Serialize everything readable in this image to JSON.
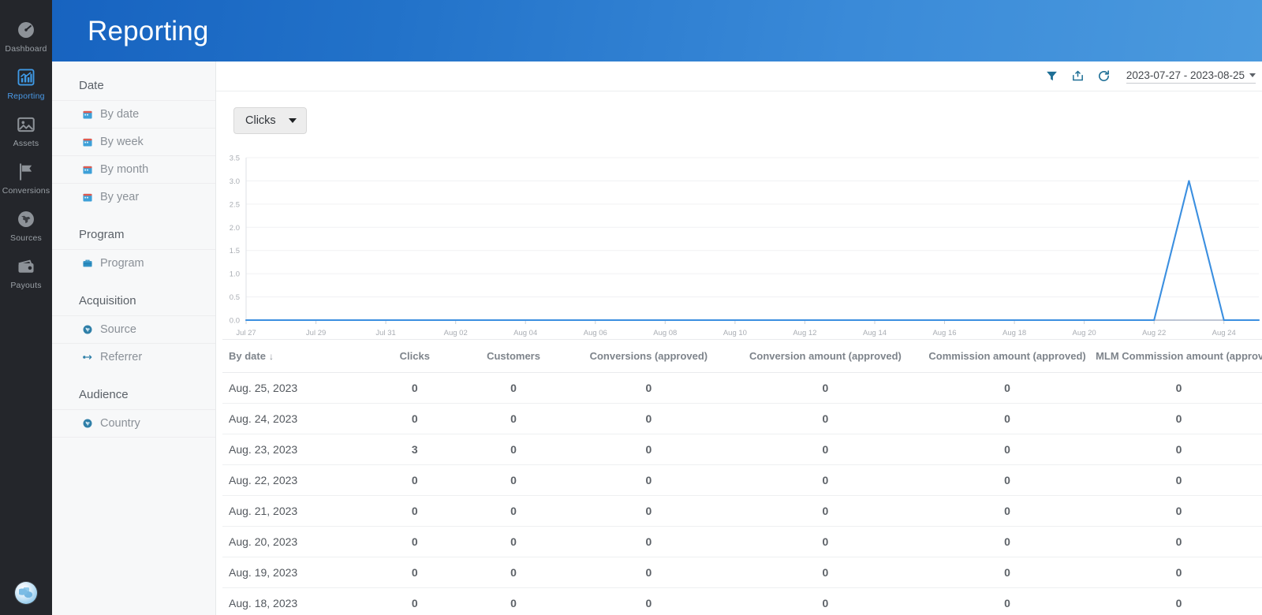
{
  "header": {
    "title": "Reporting",
    "gradient_from": "#1763c0",
    "gradient_to": "#4b9ade"
  },
  "rail": {
    "items": [
      {
        "label": "Dashboard",
        "icon": "gauge-icon",
        "active": false
      },
      {
        "label": "Reporting",
        "icon": "bar-chart-icon",
        "active": true
      },
      {
        "label": "Assets",
        "icon": "image-icon",
        "active": false
      },
      {
        "label": "Conversions",
        "icon": "flag-icon",
        "active": false
      },
      {
        "label": "Sources",
        "icon": "globe-icon",
        "active": false
      },
      {
        "label": "Payouts",
        "icon": "wallet-icon",
        "active": false
      }
    ],
    "avatar": "user-avatar"
  },
  "subnav": {
    "sections": [
      {
        "title": "Date",
        "items": [
          {
            "label": "By date",
            "icon": "calendar-icon"
          },
          {
            "label": "By week",
            "icon": "calendar-icon"
          },
          {
            "label": "By month",
            "icon": "calendar-icon"
          },
          {
            "label": "By year",
            "icon": "calendar-icon"
          }
        ]
      },
      {
        "title": "Program",
        "items": [
          {
            "label": "Program",
            "icon": "briefcase-icon"
          }
        ]
      },
      {
        "title": "Acquisition",
        "items": [
          {
            "label": "Source",
            "icon": "globe-icon"
          },
          {
            "label": "Referrer",
            "icon": "referrer-arrow-icon"
          }
        ]
      },
      {
        "title": "Audience",
        "items": [
          {
            "label": "Country",
            "icon": "globe-icon"
          }
        ]
      }
    ]
  },
  "toolbar": {
    "filter_icon": "filter-funnel-icon",
    "export_icon": "export-icon",
    "refresh_icon": "refresh-icon",
    "date_range": "2023-07-27 - 2023-08-25"
  },
  "metric_selector": {
    "value": "Clicks"
  },
  "chart_data": {
    "type": "line",
    "title": "",
    "xlabel": "",
    "ylabel": "",
    "ylim": [
      0,
      3.5
    ],
    "grid": true,
    "legend": null,
    "line_color": "#3b8fe0",
    "series": [
      {
        "name": "Clicks",
        "values": [
          0,
          0,
          0,
          0,
          0,
          0,
          0,
          0,
          0,
          0,
          0,
          0,
          0,
          0,
          0,
          0,
          0,
          0,
          0,
          0,
          0,
          0,
          0,
          0,
          0,
          0,
          0,
          3,
          0,
          0
        ]
      }
    ],
    "x": [
      "Jul 27",
      "Jul 28",
      "Jul 29",
      "Jul 30",
      "Jul 31",
      "Aug 01",
      "Aug 02",
      "Aug 03",
      "Aug 04",
      "Aug 05",
      "Aug 06",
      "Aug 07",
      "Aug 08",
      "Aug 09",
      "Aug 10",
      "Aug 11",
      "Aug 12",
      "Aug 13",
      "Aug 14",
      "Aug 15",
      "Aug 16",
      "Aug 17",
      "Aug 18",
      "Aug 19",
      "Aug 20",
      "Aug 21",
      "Aug 22",
      "Aug 23",
      "Aug 24",
      "Aug 25"
    ],
    "xticks": [
      "Jul 27",
      "Jul 29",
      "Jul 31",
      "Aug 02",
      "Aug 04",
      "Aug 06",
      "Aug 08",
      "Aug 10",
      "Aug 12",
      "Aug 14",
      "Aug 16",
      "Aug 18",
      "Aug 20",
      "Aug 22",
      "Aug 24"
    ],
    "yticks": [
      "0.0",
      "0.5",
      "1.0",
      "1.5",
      "2.0",
      "2.5",
      "3.0",
      "3.5"
    ]
  },
  "table": {
    "sort_column": "By date",
    "sort_direction": "desc",
    "columns": [
      "By date",
      "Clicks",
      "Customers",
      "Conversions (approved)",
      "Conversion amount (approved)",
      "Commission amount (approved)",
      "MLM Commission amount (approved)"
    ],
    "rows": [
      {
        "date": "Aug. 25, 2023",
        "clicks": "0",
        "customers": "0",
        "conversions": "0",
        "conversion_amount": "0",
        "commission_amount": "0",
        "mlm_commission_amount": "0"
      },
      {
        "date": "Aug. 24, 2023",
        "clicks": "0",
        "customers": "0",
        "conversions": "0",
        "conversion_amount": "0",
        "commission_amount": "0",
        "mlm_commission_amount": "0"
      },
      {
        "date": "Aug. 23, 2023",
        "clicks": "3",
        "customers": "0",
        "conversions": "0",
        "conversion_amount": "0",
        "commission_amount": "0",
        "mlm_commission_amount": "0"
      },
      {
        "date": "Aug. 22, 2023",
        "clicks": "0",
        "customers": "0",
        "conversions": "0",
        "conversion_amount": "0",
        "commission_amount": "0",
        "mlm_commission_amount": "0"
      },
      {
        "date": "Aug. 21, 2023",
        "clicks": "0",
        "customers": "0",
        "conversions": "0",
        "conversion_amount": "0",
        "commission_amount": "0",
        "mlm_commission_amount": "0"
      },
      {
        "date": "Aug. 20, 2023",
        "clicks": "0",
        "customers": "0",
        "conversions": "0",
        "conversion_amount": "0",
        "commission_amount": "0",
        "mlm_commission_amount": "0"
      },
      {
        "date": "Aug. 19, 2023",
        "clicks": "0",
        "customers": "0",
        "conversions": "0",
        "conversion_amount": "0",
        "commission_amount": "0",
        "mlm_commission_amount": "0"
      },
      {
        "date": "Aug. 18, 2023",
        "clicks": "0",
        "customers": "0",
        "conversions": "0",
        "conversion_amount": "0",
        "commission_amount": "0",
        "mlm_commission_amount": "0"
      }
    ]
  }
}
